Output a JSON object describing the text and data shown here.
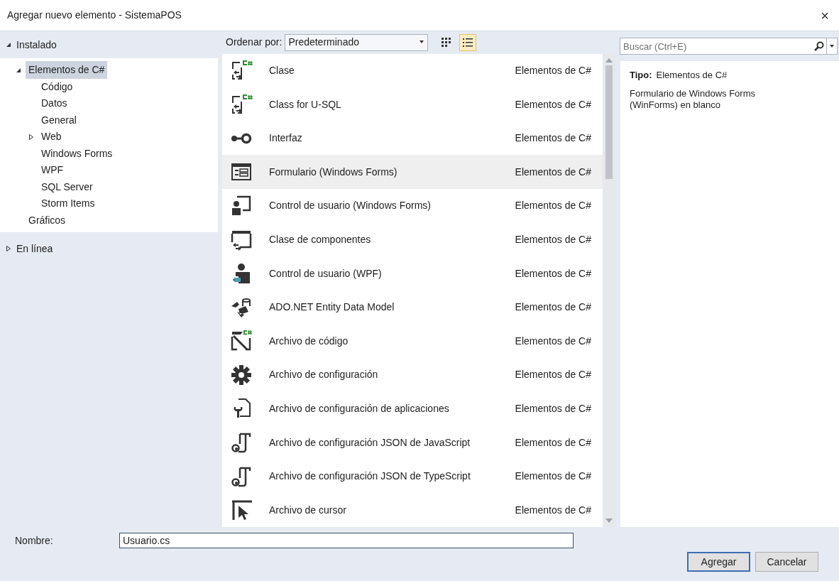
{
  "window": {
    "title": "Agregar nuevo elemento - SistemaPOS",
    "close": "×"
  },
  "sidebar": {
    "sections": [
      {
        "label": "Instalado",
        "expanded": true,
        "children": [
          {
            "label": "Elementos de C#",
            "expanded": true,
            "selected": true,
            "children": [
              {
                "label": "Código",
                "selected": false
              },
              {
                "label": "Datos",
                "selected": false
              },
              {
                "label": "General",
                "selected": false
              },
              {
                "label": "Web",
                "selected": false,
                "expanded": false
              },
              {
                "label": "Windows Forms",
                "selected": false
              },
              {
                "label": "WPF",
                "selected": false
              },
              {
                "label": "SQL Server",
                "selected": false
              },
              {
                "label": "Storm Items",
                "selected": false
              }
            ]
          },
          {
            "label": "Gráficos",
            "selected": false
          }
        ]
      },
      {
        "label": "En línea",
        "expanded": false
      }
    ]
  },
  "toolbar": {
    "sort_label": "Ordenar por:",
    "sort_value": "Predeterminado",
    "view_buttons": [
      {
        "selected": false
      },
      {
        "selected": true
      }
    ]
  },
  "search": {
    "placeholder": "Buscar (Ctrl+E)"
  },
  "templates": [
    {
      "name": "Clase",
      "category": "Elementos de C#",
      "selected": false
    },
    {
      "name": "Class for U-SQL",
      "category": "Elementos de C#",
      "selected": false
    },
    {
      "name": "Interfaz",
      "category": "Elementos de C#",
      "selected": false
    },
    {
      "name": "Formulario (Windows Forms)",
      "category": "Elementos de C#",
      "selected": true
    },
    {
      "name": "Control de usuario (Windows Forms)",
      "category": "Elementos de C#",
      "selected": false
    },
    {
      "name": "Clase de componentes",
      "category": "Elementos de C#",
      "selected": false
    },
    {
      "name": "Control de usuario (WPF)",
      "category": "Elementos de C#",
      "selected": false
    },
    {
      "name": "ADO.NET Entity Data Model",
      "category": "Elementos de C#",
      "selected": false
    },
    {
      "name": "Archivo de código",
      "category": "Elementos de C#",
      "selected": false
    },
    {
      "name": "Archivo de configuración",
      "category": "Elementos de C#",
      "selected": false
    },
    {
      "name": "Archivo de configuración de aplicaciones",
      "category": "Elementos de C#",
      "selected": false
    },
    {
      "name": "Archivo de configuración JSON de JavaScript",
      "category": "Elementos de C#",
      "selected": false
    },
    {
      "name": "Archivo de configuración JSON de TypeScript",
      "category": "Elementos de C#",
      "selected": false
    },
    {
      "name": "Archivo de cursor",
      "category": "Elementos de C#",
      "selected": false
    }
  ],
  "details": {
    "type_label": "Tipo:",
    "type_value": "Elementos de C#",
    "description": "Formulario de Windows Forms (WinForms) en blanco"
  },
  "name_field": {
    "label": "Nombre:",
    "value": "Usuario.cs"
  },
  "buttons": [
    {
      "label": "Agregar",
      "kind": "primary"
    },
    {
      "label": "Cancelar",
      "kind": "secondary"
    }
  ]
}
